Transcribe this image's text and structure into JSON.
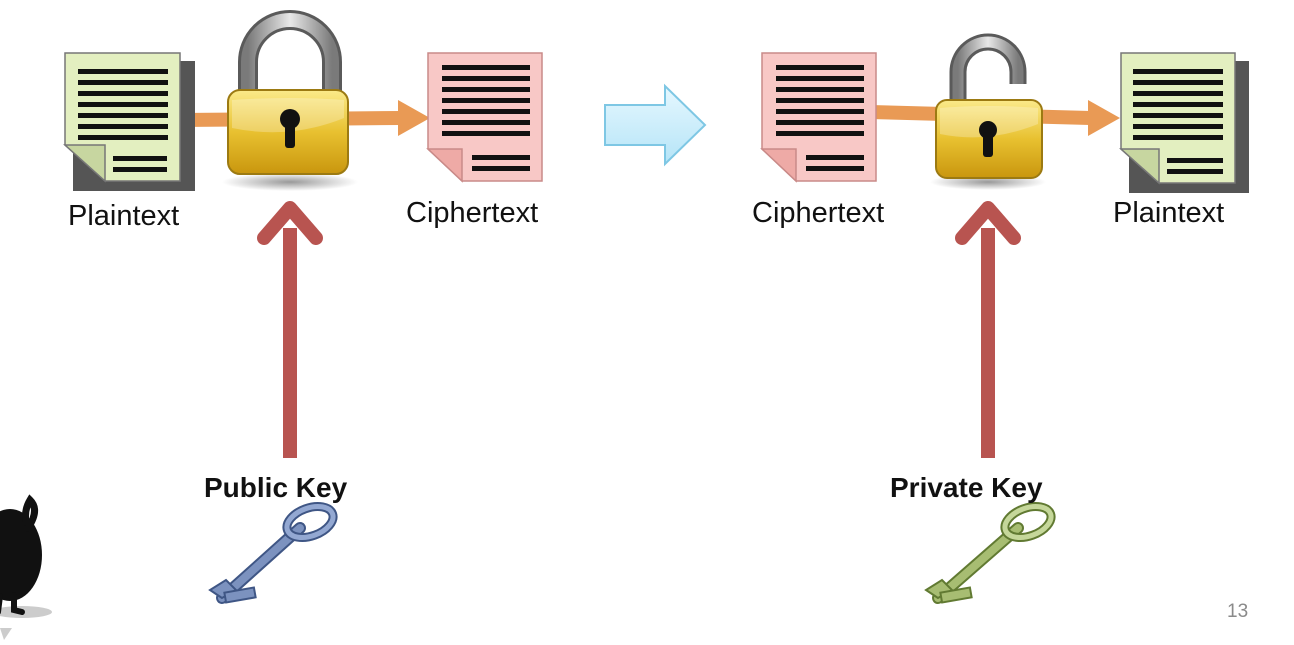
{
  "labels": {
    "plaintext_left": "Plaintext",
    "ciphertext_left": "Ciphertext",
    "ciphertext_right": "Ciphertext",
    "plaintext_right": "Plaintext",
    "public_key": "Public Key",
    "private_key": "Private Key"
  },
  "page_number": "13",
  "colors": {
    "plaintext_doc": "#e3efc0",
    "ciphertext_doc": "#f8c8c6",
    "flow_arrow": "#e99a55",
    "key_arrow": "#b85450",
    "transition_arrow": "#cdeefa",
    "lock_body": "#e8c130",
    "public_key": "#7c92bf",
    "private_key": "#a7bd72"
  },
  "icons": {
    "lock_closed": "padlock-closed-icon",
    "lock_open": "padlock-open-icon",
    "public_key": "key-icon",
    "private_key": "key-icon"
  }
}
